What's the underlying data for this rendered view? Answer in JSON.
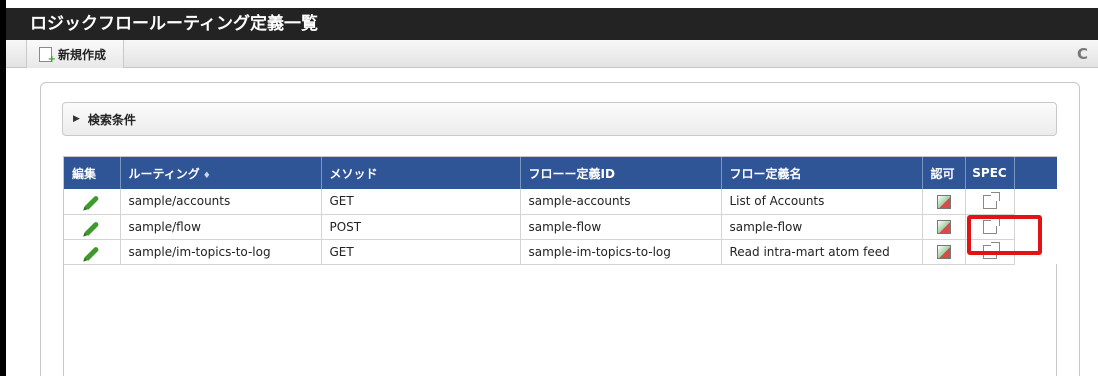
{
  "page": {
    "title": "ロジックフロールーティング定義一覧"
  },
  "toolbar": {
    "new_label": "新規作成",
    "new_icon": "new-document-icon",
    "refresh_icon": "refresh-icon",
    "refresh_glyph": "C"
  },
  "search": {
    "toggle_glyph": "▶",
    "label": "検索条件"
  },
  "table": {
    "headers": {
      "edit": "編集",
      "routing": "ルーティング",
      "sort_glyph": "♦",
      "method": "メソッド",
      "flow_id": "フローー定義ID",
      "flow_name": "フロー定義名",
      "auth": "認可",
      "spec": "SPEC"
    },
    "rows": [
      {
        "routing": "sample/accounts",
        "method": "GET",
        "flow_id": "sample-accounts",
        "flow_name": "List of Accounts"
      },
      {
        "routing": "sample/flow",
        "method": "POST",
        "flow_id": "sample-flow",
        "flow_name": "sample-flow"
      },
      {
        "routing": "sample/im-topics-to-log",
        "method": "GET",
        "flow_id": "sample-im-topics-to-log",
        "flow_name": "Read intra-mart atom feed"
      }
    ]
  },
  "colors": {
    "header_bg": "#2f5597",
    "highlight": "#e01414",
    "titlebar": "#232323"
  }
}
